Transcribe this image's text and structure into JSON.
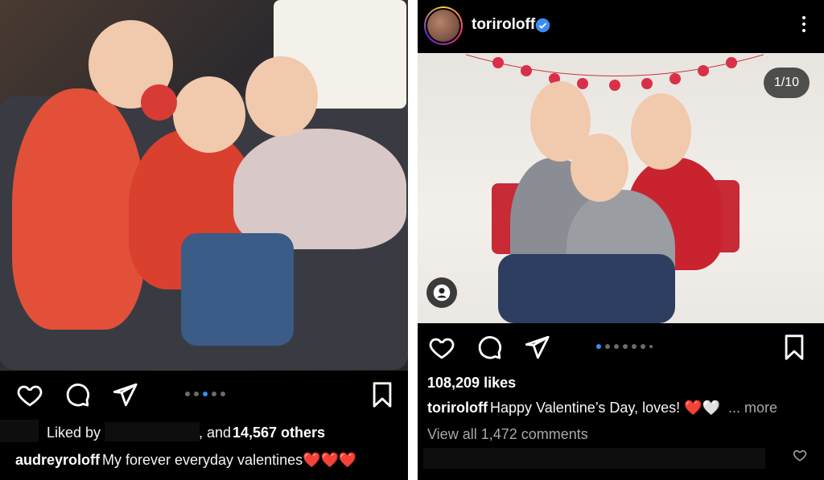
{
  "left_post": {
    "liked_by_prefix": "Liked by",
    "liked_by_suffix_pre": ", and",
    "others_count": "14,567 others",
    "caption_user": "audreyroloff",
    "caption_text": "My forever everyday valentines❤️❤️❤️",
    "carousel_dots": 5,
    "carousel_active": 3
  },
  "right_post": {
    "username": "toriroloff",
    "counter": "1/10",
    "likes": "108,209 likes",
    "caption_user": "toriroloff",
    "caption_text": "Happy Valentine’s Day, loves! ❤️🤍",
    "more_label": "... more",
    "view_comments": "View all 1,472 comments",
    "carousel_dots": 7,
    "carousel_active": 1
  },
  "colors": {
    "background": "#000000",
    "accent_blue": "#3a8cf5",
    "heart_red": "#e03a3a"
  },
  "icons": [
    "heart-icon",
    "comment-icon",
    "share-icon",
    "bookmark-icon",
    "more-icon",
    "verified-icon",
    "user-tag-icon"
  ]
}
